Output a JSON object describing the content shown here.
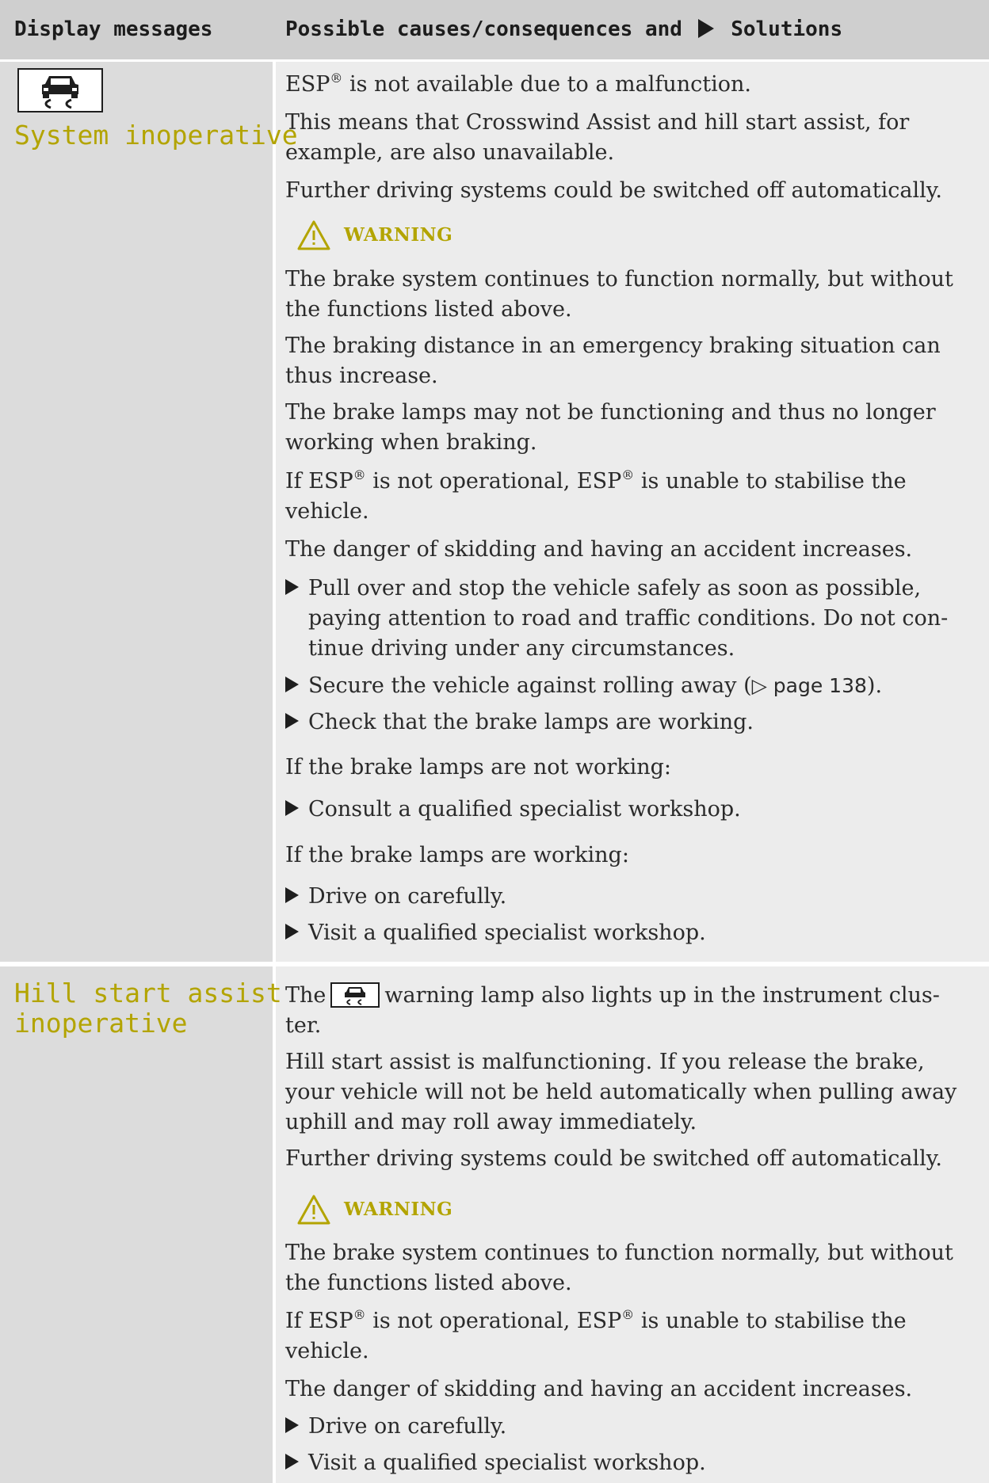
{
  "header": {
    "display_messages": "Display messages",
    "causes_prefix": "Possible causes/consequences and",
    "causes_suffix": "Solutions"
  },
  "rows": [
    {
      "display_message": "System inoperative",
      "icon": "esp-skid-warning-icon",
      "paragraphs": {
        "p1": "ESP",
        "p1_reg": "®",
        "p1_rest": " is not available due to a malfunction.",
        "p2_line1": "This means that Crosswind Assist and hill start assist, for",
        "p2_line2": "example, are also unavailable.",
        "p3": "Further driving systems could be switched off automatically."
      },
      "warning_label": "WARNING",
      "warning_text": {
        "w1_line1": "The brake system continues to function normally, but without",
        "w1_line2": "the functions listed above.",
        "w2_line1": "The braking distance in an emergency braking situation can",
        "w2_line2": "thus increase.",
        "w3_line1": "The brake lamps may not be functioning and thus no longer",
        "w3_line2": "working when braking.",
        "w4_a": "If ESP",
        "w4_b": " is not operational, ESP",
        "w4_c": " is unable to stabilise the",
        "w4_line2": "vehicle.",
        "w5": "The danger of skidding and having an accident increases."
      },
      "steps": {
        "s1_line1": "Pull over and stop the vehicle safely as soon as possible,",
        "s1_line2": "paying attention to road and traffic conditions. Do not con-",
        "s1_line3": "tinue driving under any circumstances.",
        "s2": "Secure the vehicle against rolling away (",
        "s2_ref": "▷ page 138",
        "s2_end": ").",
        "s3": "Check that the brake lamps are working.",
        "cond1": "If the brake lamps are not working:",
        "s4": "Consult a qualified specialist workshop.",
        "cond2": "If the brake lamps are working:",
        "s5": "Drive on carefully.",
        "s6": "Visit a qualified specialist workshop."
      }
    },
    {
      "display_message_line1": "Hill start assist",
      "display_message_line2": "inoperative",
      "paragraphs": {
        "p1_a": "The",
        "p1_b": "warning lamp also lights up in the instrument clus-",
        "p1_line2": "ter.",
        "p2_line1": "Hill start assist is malfunctioning. If you release the brake,",
        "p2_line2": "your vehicle will not be held automatically when pulling away",
        "p2_line3": "uphill and may roll away immediately.",
        "p3": "Further driving systems could be switched off automatically."
      },
      "warning_label": "WARNING",
      "warning_text": {
        "w1_line1": "The brake system continues to function normally, but without",
        "w1_line2": "the functions listed above.",
        "w2_a": "If ESP",
        "w2_b": " is not operational, ESP",
        "w2_c": " is unable to stabilise the",
        "w2_line2": "vehicle.",
        "w3": "The danger of skidding and having an accident increases."
      },
      "steps": {
        "s1": "Drive on carefully.",
        "s2": "Visit a qualified specialist workshop."
      }
    }
  ],
  "registered_mark": "®",
  "colors": {
    "accent_yellow": "#b3a400",
    "left_column": "#dcdcdc",
    "right_column": "#ececec",
    "header": "#cfcfcf"
  }
}
